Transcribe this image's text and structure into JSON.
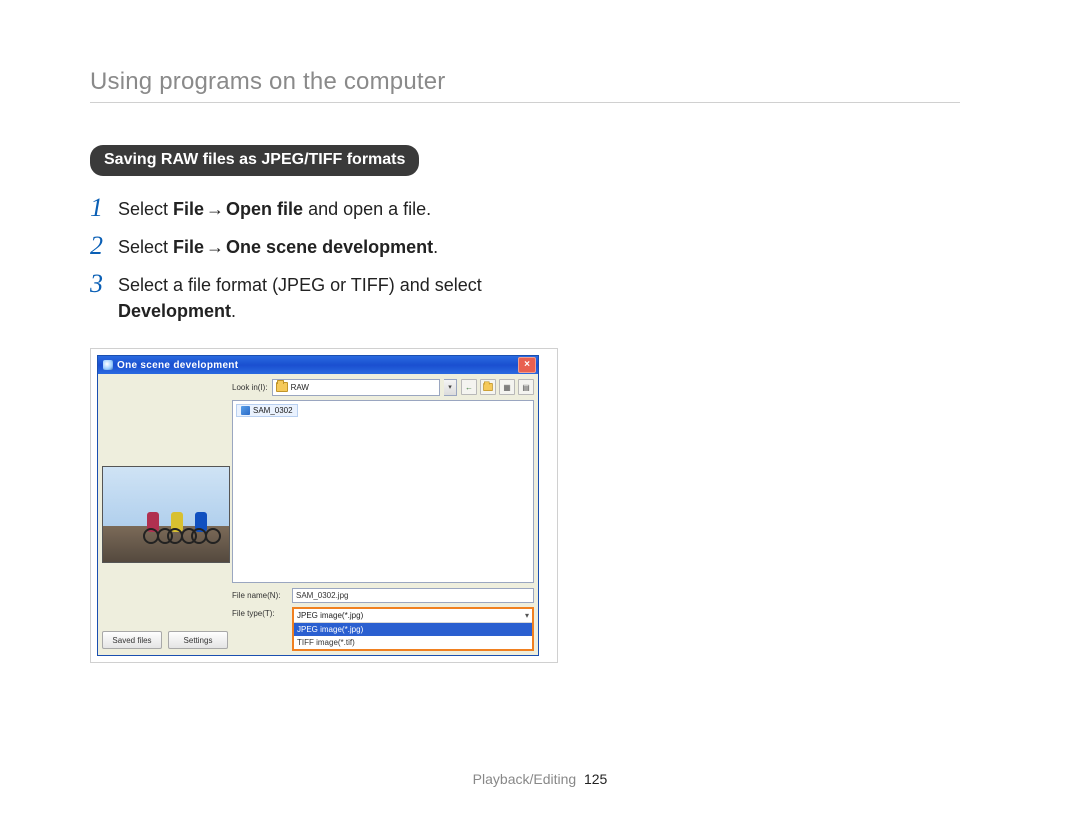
{
  "header": {
    "section_title": "Using programs on the computer"
  },
  "pill": {
    "label": "Saving RAW files as JPEG/TIFF formats"
  },
  "steps": {
    "s1": {
      "pre": "Select ",
      "bold1": "File",
      "arrow": " → ",
      "bold2": "Open file",
      "post": " and open a file."
    },
    "s2": {
      "pre": "Select ",
      "bold1": "File",
      "arrow": " → ",
      "bold2": "One scene development",
      "post": "."
    },
    "s3": {
      "line1": "Select a file format (JPEG or TIFF) and select",
      "bold": "Development",
      "post": "."
    },
    "nums": {
      "n1": "1",
      "n2": "2",
      "n3": "3"
    }
  },
  "dialog": {
    "title": "One scene development",
    "close_glyph": "×",
    "lookin_label": "Look in(I):",
    "lookin_value": "RAW",
    "toolbar": {
      "back": "←",
      "view": "▦",
      "new": "▤"
    },
    "file_item": "SAM_0302",
    "filename_label": "File name(N):",
    "filename_value": "SAM_0302.jpg",
    "filetype_label": "File type(T):",
    "filetype_selected": "JPEG image(*.jpg)",
    "filetype_opt_highlight": "JPEG image(*.jpg)",
    "filetype_opt_other": "TIFF image(*.tif)",
    "btn_saved": "Saved files",
    "btn_settings": "Settings"
  },
  "footer": {
    "category": "Playback/Editing",
    "page": "125"
  }
}
